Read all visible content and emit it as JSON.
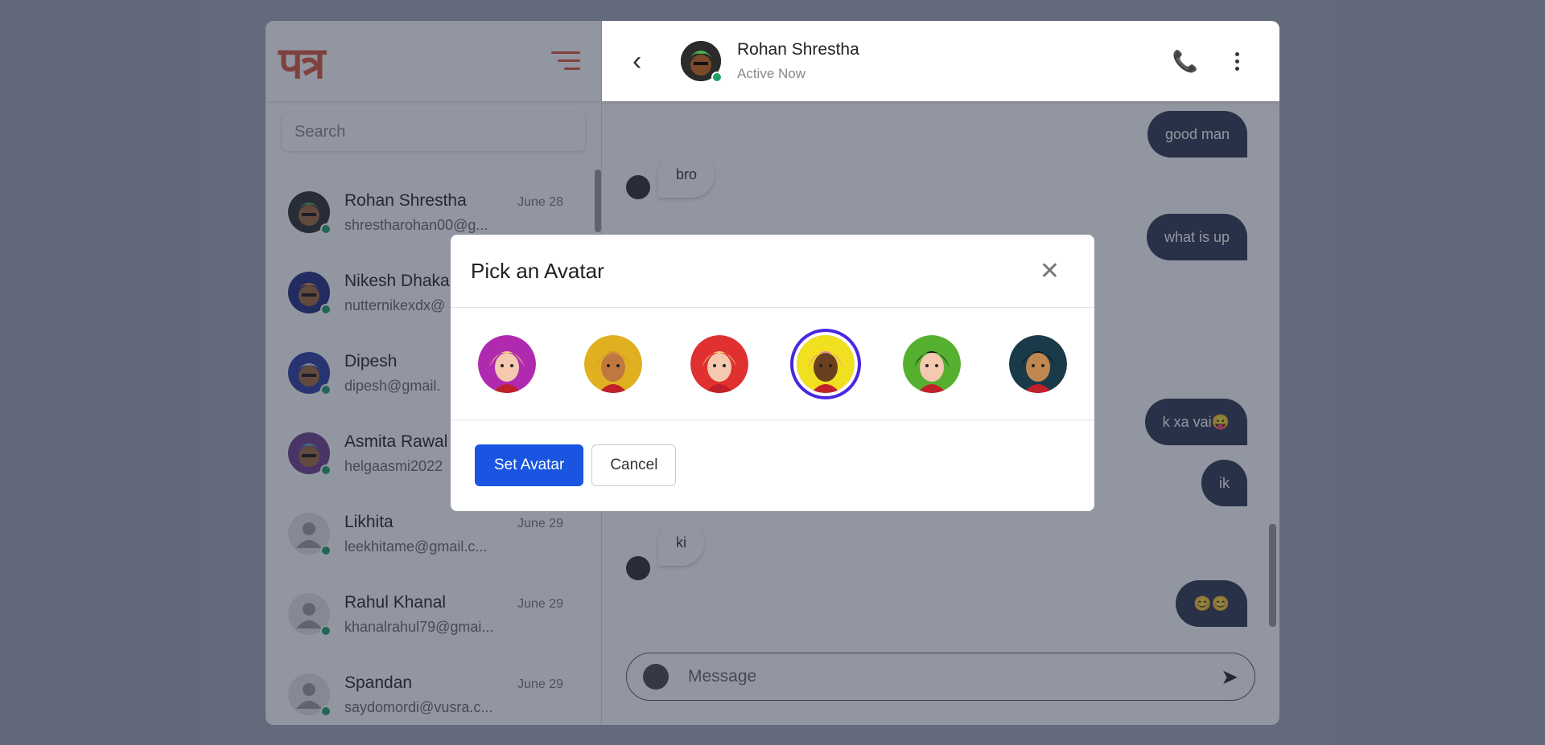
{
  "app": {
    "logo": "पत्र"
  },
  "search": {
    "placeholder": "Search"
  },
  "contacts": [
    {
      "name": "Rohan Shrestha",
      "date": "June 28",
      "email": "shrestharohan00@g...",
      "avatar_color": "#2b2b2b",
      "hair": "#4caf50"
    },
    {
      "name": "Nikesh Dhakal",
      "date": "",
      "email": "nutternikexdx@",
      "avatar_color": "#1f2a80",
      "hair": "#e08a3a"
    },
    {
      "name": "Dipesh",
      "date": "",
      "email": "dipesh@gmail.",
      "avatar_color": "#2a3aa0",
      "hair": "#ddd"
    },
    {
      "name": "Asmita Rawal",
      "date": "",
      "email": "helgaasmi2022",
      "avatar_color": "#6a3d8a",
      "hair": "#5ab0c0"
    },
    {
      "name": "Likhita",
      "date": "June 29",
      "email": "leekhitame@gmail.c...",
      "avatar_color": "#e4e4e4",
      "hair": "#9a9a9a"
    },
    {
      "name": "Rahul Khanal",
      "date": "June 29",
      "email": "khanalrahul79@gmai...",
      "avatar_color": "#e4e4e4",
      "hair": "#9a9a9a"
    },
    {
      "name": "Spandan",
      "date": "June 29",
      "email": "saydomordi@vusra.c...",
      "avatar_color": "#e4e4e4",
      "hair": "#9a9a9a"
    }
  ],
  "chat": {
    "name": "Rohan Shrestha",
    "status": "Active Now",
    "messages": [
      {
        "type": "sent",
        "text": "good man"
      },
      {
        "type": "recv",
        "text": "bro"
      },
      {
        "type": "sent",
        "text": "what is up"
      },
      {
        "type": "sent",
        "text": "k xa vai😛"
      },
      {
        "type": "sent",
        "text": "ik"
      },
      {
        "type": "recv",
        "text": "ki"
      },
      {
        "type": "sent",
        "text": "😊😊"
      }
    ],
    "composer_placeholder": "Message"
  },
  "modal": {
    "title": "Pick an Avatar",
    "avatars": [
      {
        "bg": "#b02ab0",
        "face": "#f4c9b0",
        "hair": "#f5d96a"
      },
      {
        "bg": "#e0b020",
        "face": "#c07840",
        "hair": "#e08a3a"
      },
      {
        "bg": "#e03030",
        "face": "#f4c9b0",
        "hair": "#f5d96a"
      },
      {
        "bg": "#f0e020",
        "face": "#6a4020",
        "hair": "#f07ad0"
      },
      {
        "bg": "#55b030",
        "face": "#f4c9b0",
        "hair": "#111"
      },
      {
        "bg": "#1a3a4a",
        "face": "#c08850",
        "hair": "#111"
      }
    ],
    "selected_index": 3,
    "set_label": "Set Avatar",
    "cancel_label": "Cancel"
  }
}
